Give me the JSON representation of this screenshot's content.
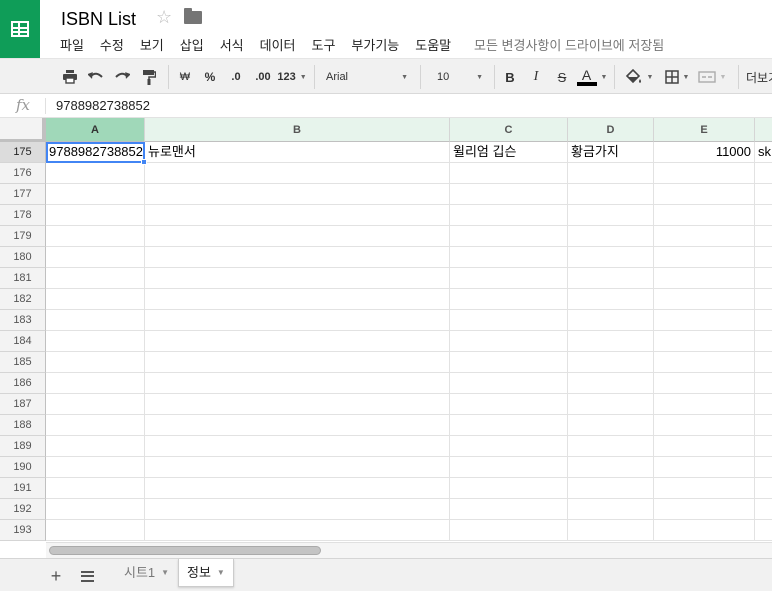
{
  "doc": {
    "title": "ISBN List",
    "save_status": "모든 변경사항이 드라이브에 저장됨"
  },
  "menu": [
    "파일",
    "수정",
    "보기",
    "삽입",
    "서식",
    "데이터",
    "도구",
    "부가기능",
    "도움말"
  ],
  "toolbar": {
    "currency": "₩",
    "percent": "%",
    "decrease_decimal": ".0",
    "increase_decimal": ".00",
    "number_format": "123",
    "font": "Arial",
    "font_size": "10",
    "bold": "B",
    "italic": "I",
    "strike": "S",
    "text_color_letter": "A",
    "more": "더보기"
  },
  "formula_bar": {
    "fx": "fx",
    "value": "9788982738852"
  },
  "columns": [
    "A",
    "B",
    "C",
    "D",
    "E"
  ],
  "rows": [
    {
      "num": "175",
      "cells": [
        "9788982738852",
        "뉴로맨서",
        "윌리엄 깁슨",
        "황금가지",
        "11000",
        "sk"
      ]
    },
    {
      "num": "176",
      "cells": []
    },
    {
      "num": "177",
      "cells": []
    },
    {
      "num": "178",
      "cells": []
    },
    {
      "num": "179",
      "cells": []
    },
    {
      "num": "180",
      "cells": []
    },
    {
      "num": "181",
      "cells": []
    },
    {
      "num": "182",
      "cells": []
    },
    {
      "num": "183",
      "cells": []
    },
    {
      "num": "184",
      "cells": []
    },
    {
      "num": "185",
      "cells": []
    },
    {
      "num": "186",
      "cells": []
    },
    {
      "num": "187",
      "cells": []
    },
    {
      "num": "188",
      "cells": []
    },
    {
      "num": "189",
      "cells": []
    },
    {
      "num": "190",
      "cells": []
    },
    {
      "num": "191",
      "cells": []
    },
    {
      "num": "192",
      "cells": []
    },
    {
      "num": "193",
      "cells": []
    }
  ],
  "selected_cell": "A175",
  "sheets": [
    {
      "name": "시트1",
      "active": false
    },
    {
      "name": "정보",
      "active": true
    }
  ],
  "colors": {
    "brand": "#0f9d58",
    "active_col_header": "#a0d8b9",
    "selection": "#4285f4"
  }
}
